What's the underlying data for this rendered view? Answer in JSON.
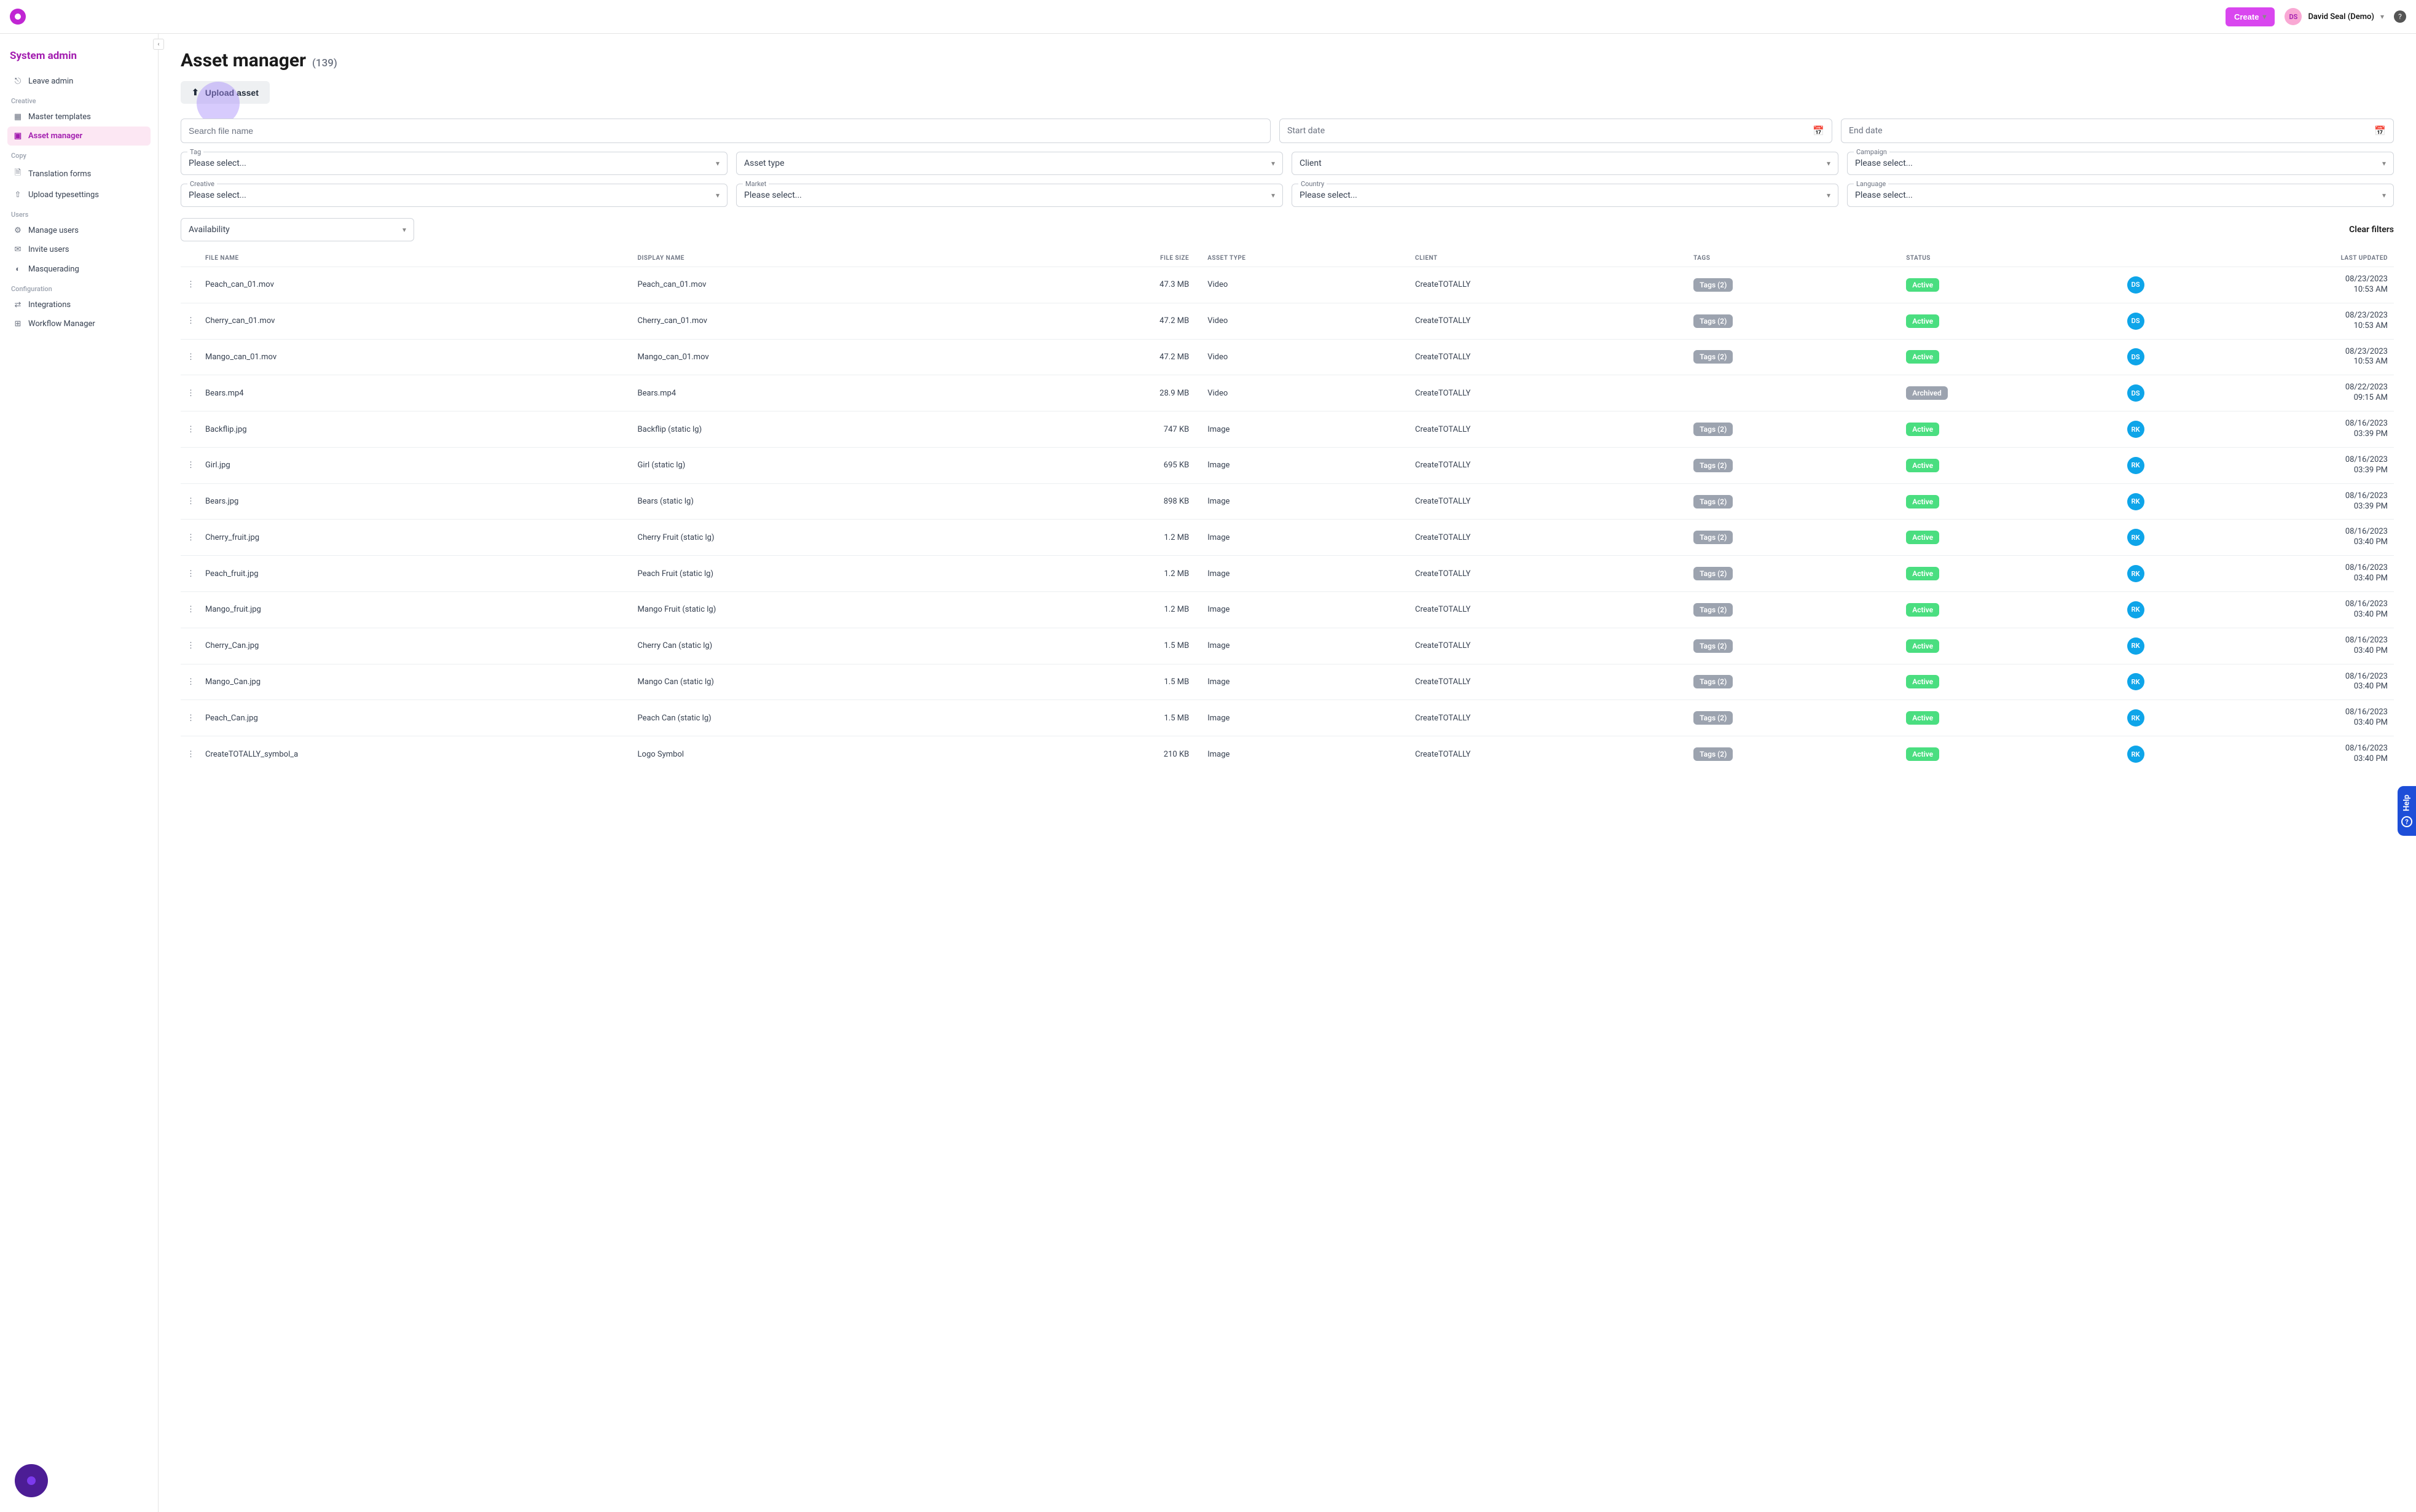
{
  "topbar": {
    "create_label": "Create",
    "user_initials": "DS",
    "user_name": "David Seal (Demo)"
  },
  "sidebar": {
    "title": "System admin",
    "leave_label": "Leave admin",
    "groups": [
      {
        "label": "Creative",
        "items": [
          {
            "icon": "▦",
            "label": "Master templates",
            "name": "master-templates",
            "active": false
          },
          {
            "icon": "▣",
            "label": "Asset manager",
            "name": "asset-manager",
            "active": true
          }
        ]
      },
      {
        "label": "Copy",
        "items": [
          {
            "icon": "🗎",
            "label": "Translation forms",
            "name": "translation-forms",
            "active": false
          },
          {
            "icon": "⇧",
            "label": "Upload typesettings",
            "name": "upload-typesettings",
            "active": false
          }
        ]
      },
      {
        "label": "Users",
        "items": [
          {
            "icon": "⚙",
            "label": "Manage users",
            "name": "manage-users",
            "active": false
          },
          {
            "icon": "✉",
            "label": "Invite users",
            "name": "invite-users",
            "active": false
          },
          {
            "icon": "◐",
            "label": "Masquerading",
            "name": "masquerading",
            "active": false
          }
        ]
      },
      {
        "label": "Configuration",
        "items": [
          {
            "icon": "⇄",
            "label": "Integrations",
            "name": "integrations",
            "active": false
          },
          {
            "icon": "⊞",
            "label": "Workflow Manager",
            "name": "workflow-manager",
            "active": false
          }
        ]
      }
    ]
  },
  "page": {
    "title": "Asset manager",
    "count": "(139)",
    "upload_label": "Upload asset"
  },
  "filters": {
    "search_placeholder": "Search file name",
    "start_date": "Start date",
    "end_date": "End date",
    "tag_label": "Tag",
    "tag_value": "Please select...",
    "asset_type": "Asset type",
    "client": "Client",
    "campaign_label": "Campaign",
    "campaign_value": "Please select...",
    "creative_label": "Creative",
    "creative_value": "Please select...",
    "market_label": "Market",
    "market_value": "Please select...",
    "country_label": "Country",
    "country_value": "Please select...",
    "language_label": "Language",
    "language_value": "Please select...",
    "availability": "Availability",
    "clear_filters": "Clear filters"
  },
  "table": {
    "headers": {
      "file_name": "FILE NAME",
      "display_name": "DISPLAY NAME",
      "file_size": "FILE SIZE",
      "asset_type": "ASSET TYPE",
      "client": "CLIENT",
      "tags": "TAGS",
      "status": "STATUS",
      "last_updated": "LAST UPDATED"
    },
    "rows": [
      {
        "file": "Peach_can_01.mov",
        "display": "Peach_can_01.mov",
        "size": "47.3 MB",
        "type": "Video",
        "client": "CreateTOTALLY",
        "tags": "Tags (2)",
        "status": "Active",
        "status_color": "green",
        "av": "DS",
        "av_color": "blue",
        "date1": "08/23/2023",
        "date2": "10:53 AM"
      },
      {
        "file": "Cherry_can_01.mov",
        "display": "Cherry_can_01.mov",
        "size": "47.2 MB",
        "type": "Video",
        "client": "CreateTOTALLY",
        "tags": "Tags (2)",
        "status": "Active",
        "status_color": "green",
        "av": "DS",
        "av_color": "blue",
        "date1": "08/23/2023",
        "date2": "10:53 AM"
      },
      {
        "file": "Mango_can_01.mov",
        "display": "Mango_can_01.mov",
        "size": "47.2 MB",
        "type": "Video",
        "client": "CreateTOTALLY",
        "tags": "Tags (2)",
        "status": "Active",
        "status_color": "green",
        "av": "DS",
        "av_color": "blue",
        "date1": "08/23/2023",
        "date2": "10:53 AM"
      },
      {
        "file": "Bears.mp4",
        "display": "Bears.mp4",
        "size": "28.9 MB",
        "type": "Video",
        "client": "CreateTOTALLY",
        "tags": "",
        "status": "Archived",
        "status_color": "grey",
        "av": "DS",
        "av_color": "blue",
        "date1": "08/22/2023",
        "date2": "09:15 AM"
      },
      {
        "file": "Backflip.jpg",
        "display": "Backflip (static lg)",
        "size": "747 KB",
        "type": "Image",
        "client": "CreateTOTALLY",
        "tags": "Tags (2)",
        "status": "Active",
        "status_color": "green",
        "av": "RK",
        "av_color": "blue",
        "date1": "08/16/2023",
        "date2": "03:39 PM"
      },
      {
        "file": "Girl.jpg",
        "display": "Girl (static lg)",
        "size": "695 KB",
        "type": "Image",
        "client": "CreateTOTALLY",
        "tags": "Tags (2)",
        "status": "Active",
        "status_color": "green",
        "av": "RK",
        "av_color": "blue",
        "date1": "08/16/2023",
        "date2": "03:39 PM"
      },
      {
        "file": "Bears.jpg",
        "display": "Bears (static lg)",
        "size": "898 KB",
        "type": "Image",
        "client": "CreateTOTALLY",
        "tags": "Tags (2)",
        "status": "Active",
        "status_color": "green",
        "av": "RK",
        "av_color": "blue",
        "date1": "08/16/2023",
        "date2": "03:39 PM"
      },
      {
        "file": "Cherry_fruit.jpg",
        "display": "Cherry Fruit (static lg)",
        "size": "1.2 MB",
        "type": "Image",
        "client": "CreateTOTALLY",
        "tags": "Tags (2)",
        "status": "Active",
        "status_color": "green",
        "av": "RK",
        "av_color": "blue",
        "date1": "08/16/2023",
        "date2": "03:40 PM"
      },
      {
        "file": "Peach_fruit.jpg",
        "display": "Peach Fruit (static lg)",
        "size": "1.2 MB",
        "type": "Image",
        "client": "CreateTOTALLY",
        "tags": "Tags (2)",
        "status": "Active",
        "status_color": "green",
        "av": "RK",
        "av_color": "blue",
        "date1": "08/16/2023",
        "date2": "03:40 PM"
      },
      {
        "file": "Mango_fruit.jpg",
        "display": "Mango Fruit (static lg)",
        "size": "1.2 MB",
        "type": "Image",
        "client": "CreateTOTALLY",
        "tags": "Tags (2)",
        "status": "Active",
        "status_color": "green",
        "av": "RK",
        "av_color": "blue",
        "date1": "08/16/2023",
        "date2": "03:40 PM"
      },
      {
        "file": "Cherry_Can.jpg",
        "display": "Cherry Can (static lg)",
        "size": "1.5 MB",
        "type": "Image",
        "client": "CreateTOTALLY",
        "tags": "Tags (2)",
        "status": "Active",
        "status_color": "green",
        "av": "RK",
        "av_color": "blue",
        "date1": "08/16/2023",
        "date2": "03:40 PM"
      },
      {
        "file": "Mango_Can.jpg",
        "display": "Mango Can (static lg)",
        "size": "1.5 MB",
        "type": "Image",
        "client": "CreateTOTALLY",
        "tags": "Tags (2)",
        "status": "Active",
        "status_color": "green",
        "av": "RK",
        "av_color": "blue",
        "date1": "08/16/2023",
        "date2": "03:40 PM"
      },
      {
        "file": "Peach_Can.jpg",
        "display": "Peach Can (static lg)",
        "size": "1.5 MB",
        "type": "Image",
        "client": "CreateTOTALLY",
        "tags": "Tags (2)",
        "status": "Active",
        "status_color": "green",
        "av": "RK",
        "av_color": "blue",
        "date1": "08/16/2023",
        "date2": "03:40 PM"
      },
      {
        "file": "CreateTOTALLY_symbol_a",
        "display": "Logo Symbol",
        "size": "210 KB",
        "type": "Image",
        "client": "CreateTOTALLY",
        "tags": "Tags (2)",
        "status": "Active",
        "status_color": "green",
        "av": "RK",
        "av_color": "blue",
        "date1": "08/16/2023",
        "date2": "03:40 PM"
      }
    ]
  },
  "help_tab": "Help"
}
